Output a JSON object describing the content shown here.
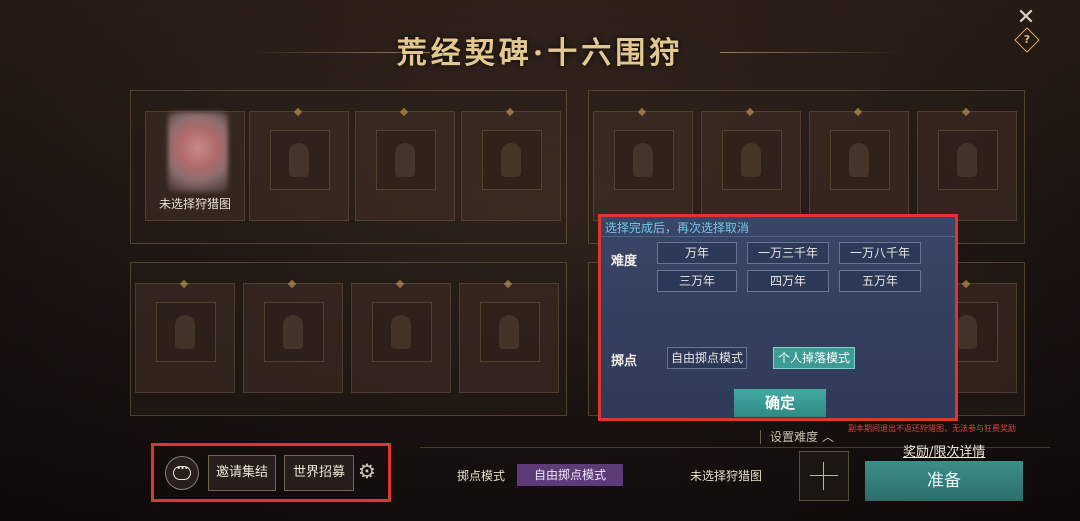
{
  "title": "荒经契碑·十六围狩",
  "top_icons": {
    "close": "close-icon",
    "help": "?"
  },
  "slots": {
    "first_slot_label": "未选择狩猎图"
  },
  "dialog": {
    "hint": "选择完成后，再次选择取消",
    "difficulty_label": "难度",
    "difficulty_options": [
      "万年",
      "一万三千年",
      "一万八千年",
      "三万年",
      "四万年",
      "五万年"
    ],
    "drop_label": "掷点",
    "drop_options": [
      {
        "label": "自由掷点模式",
        "selected": false
      },
      {
        "label": "个人掉落模式",
        "selected": true
      }
    ],
    "confirm": "确定"
  },
  "bottom": {
    "set_difficulty": "设置难度",
    "notice": "副本期间退出不返还狩猎图，无法参与狂费奖励",
    "reward_link": "奖励/限次详情",
    "invite": "邀请集结",
    "world_recruit": "世界招募",
    "mode_label": "掷点模式",
    "mode_value": "自由掷点模式",
    "unselected_map": "未选择狩猎图",
    "ready": "准备"
  },
  "colors": {
    "highlight_red": "#e0352f",
    "accent_teal": "#3d9b95",
    "mode_purple": "#5c3b76",
    "title_gold": "#e3c98f"
  }
}
